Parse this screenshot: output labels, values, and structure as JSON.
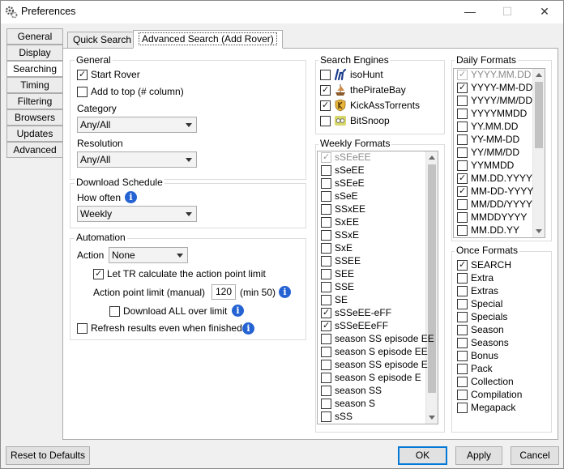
{
  "window": {
    "title": "Preferences",
    "minimize": "—",
    "maximize": "☐",
    "close": "✕"
  },
  "side_tabs": [
    "General",
    "Display",
    "Searching",
    "Timing",
    "Filtering",
    "Browsers",
    "Updates",
    "Advanced"
  ],
  "top_tabs": [
    "Quick Search",
    "Advanced Search (Add Rover)"
  ],
  "general": {
    "title": "General",
    "start_rover": "Start Rover",
    "add_to_top": "Add to top (# column)",
    "category_label": "Category",
    "category_value": "Any/All",
    "resolution_label": "Resolution",
    "resolution_value": "Any/All"
  },
  "schedule": {
    "title": "Download Schedule",
    "how_often_label": "How often",
    "how_often_value": "Weekly"
  },
  "automation": {
    "title": "Automation",
    "action_label": "Action",
    "action_value": "None",
    "let_tr": "Let TR calculate the action point limit",
    "apl_label": "Action point limit (manual)",
    "apl_value": "120",
    "apl_min": "(min 50)",
    "download_all": "Download ALL over limit",
    "refresh": "Refresh results even when finished"
  },
  "search_engines": {
    "title": "Search Engines",
    "items": [
      {
        "label": "isoHunt",
        "checked": false,
        "icon": "isohunt-icon"
      },
      {
        "label": "thePirateBay",
        "checked": true,
        "icon": "pirate-ship-icon"
      },
      {
        "label": "KickAssTorrents",
        "checked": true,
        "icon": "kat-icon"
      },
      {
        "label": "BitSnoop",
        "checked": false,
        "icon": "bitsnoop-icon"
      }
    ]
  },
  "weekly_formats": {
    "title": "Weekly Formats",
    "items": [
      {
        "label": "sSEeEE",
        "checked": true,
        "dim": true
      },
      {
        "label": "sSeEE",
        "checked": false
      },
      {
        "label": "sSEeE",
        "checked": false
      },
      {
        "label": "sSeE",
        "checked": false
      },
      {
        "label": "SSxEE",
        "checked": false
      },
      {
        "label": "SxEE",
        "checked": false
      },
      {
        "label": "SSxE",
        "checked": false
      },
      {
        "label": "SxE",
        "checked": false
      },
      {
        "label": "SSEE",
        "checked": false
      },
      {
        "label": "SEE",
        "checked": false
      },
      {
        "label": "SSE",
        "checked": false
      },
      {
        "label": "SE",
        "checked": false
      },
      {
        "label": "sSSeEE-eFF",
        "checked": true
      },
      {
        "label": "sSSeEEeFF",
        "checked": true
      },
      {
        "label": "season SS episode EE",
        "checked": false
      },
      {
        "label": "season S episode EE",
        "checked": false
      },
      {
        "label": "season SS episode E",
        "checked": false
      },
      {
        "label": "season S episode E",
        "checked": false
      },
      {
        "label": "season SS",
        "checked": false
      },
      {
        "label": "season S",
        "checked": false
      },
      {
        "label": "sSS",
        "checked": false
      }
    ]
  },
  "daily_formats": {
    "title": "Daily Formats",
    "items": [
      {
        "label": "YYYY.MM.DD",
        "checked": true,
        "dim": true
      },
      {
        "label": "YYYY-MM-DD",
        "checked": true
      },
      {
        "label": "YYYY/MM/DD",
        "checked": false
      },
      {
        "label": "YYYYMMDD",
        "checked": false
      },
      {
        "label": "YY.MM.DD",
        "checked": false
      },
      {
        "label": "YY-MM-DD",
        "checked": false
      },
      {
        "label": "YY/MM/DD",
        "checked": false
      },
      {
        "label": "YYMMDD",
        "checked": false
      },
      {
        "label": "MM.DD.YYYY",
        "checked": true
      },
      {
        "label": "MM-DD-YYYY",
        "checked": true
      },
      {
        "label": "MM/DD/YYYY",
        "checked": false
      },
      {
        "label": "MMDDYYYY",
        "checked": false
      },
      {
        "label": "MM.DD.YY",
        "checked": false
      }
    ]
  },
  "once_formats": {
    "title": "Once Formats",
    "items": [
      {
        "label": "SEARCH",
        "checked": true
      },
      {
        "label": "Extra",
        "checked": false
      },
      {
        "label": "Extras",
        "checked": false
      },
      {
        "label": "Special",
        "checked": false
      },
      {
        "label": "Specials",
        "checked": false
      },
      {
        "label": "Season",
        "checked": false
      },
      {
        "label": "Seasons",
        "checked": false
      },
      {
        "label": "Bonus",
        "checked": false
      },
      {
        "label": "Pack",
        "checked": false
      },
      {
        "label": "Collection",
        "checked": false
      },
      {
        "label": "Compilation",
        "checked": false
      },
      {
        "label": "Megapack",
        "checked": false
      }
    ]
  },
  "buttons": {
    "reset": "Reset to Defaults",
    "ok": "OK",
    "apply": "Apply",
    "cancel": "Cancel"
  },
  "colors": {
    "accent": "#0078d7",
    "info": "#2563d3"
  }
}
